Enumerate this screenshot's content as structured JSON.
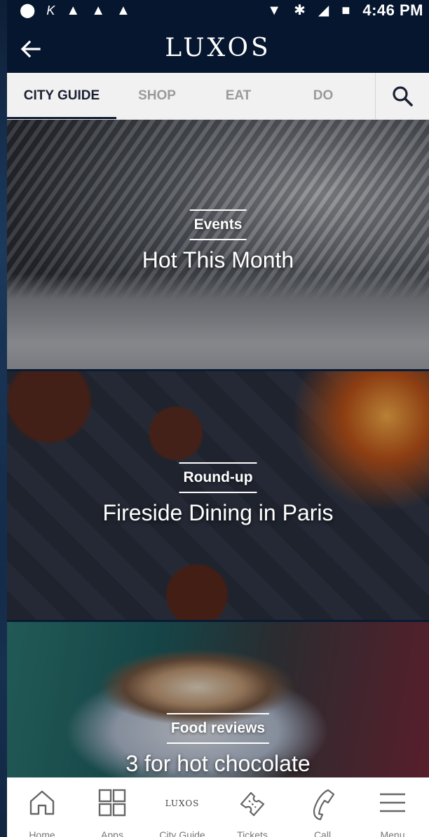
{
  "status_bar": {
    "time": "4:46 PM",
    "icons": [
      "shield-icon",
      "k-icon",
      "warning-icon",
      "warning-icon",
      "warning-icon",
      "signal-icon",
      "bluetooth-icon",
      "network-icon",
      "battery-icon"
    ]
  },
  "app_bar": {
    "title": "LUXOS",
    "back_icon": "arrow-left-icon"
  },
  "tabs": [
    {
      "label": "CITY GUIDE",
      "active": true
    },
    {
      "label": "SHOP",
      "active": false
    },
    {
      "label": "EAT",
      "active": false
    },
    {
      "label": "DO",
      "active": false
    }
  ],
  "search_icon": "search-icon",
  "cards": [
    {
      "eyebrow": "Events",
      "headline": "Hot This Month"
    },
    {
      "eyebrow": "Round-up",
      "headline": "Fireside Dining in Paris"
    },
    {
      "eyebrow": "Food reviews",
      "headline": "3 for hot chocolate"
    }
  ],
  "bottom_nav": [
    {
      "label": "Home",
      "icon": "home-icon"
    },
    {
      "label": "Apps",
      "icon": "grid-icon"
    },
    {
      "label": "City Guide",
      "icon": "luxos-logo",
      "logo_text": "LUXOS"
    },
    {
      "label": "Tickets",
      "icon": "ticket-icon"
    },
    {
      "label": "Call",
      "icon": "phone-icon"
    },
    {
      "label": "Menu",
      "icon": "menu-icon"
    }
  ],
  "colors": {
    "header_bg": "#06162e",
    "tab_bar_bg": "#f1f1f1",
    "tab_active": "#1a2033",
    "tab_inactive": "#9a9a9a"
  }
}
